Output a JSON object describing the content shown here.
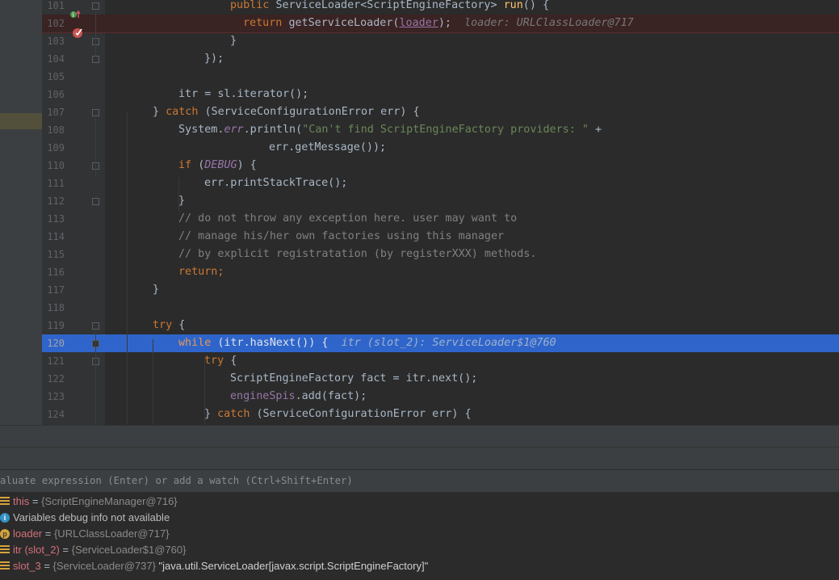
{
  "editor": {
    "lines": [
      {
        "num": "101",
        "segments": [
          {
            "t": "public ",
            "c": "kw"
          },
          {
            "t": "ServiceLoader<ScriptEngineFactory> ",
            "c": ""
          },
          {
            "t": "run",
            "c": "fn"
          },
          {
            "t": "() {",
            "c": ""
          }
        ]
      },
      {
        "num": "102",
        "segments": [
          {
            "t": "return ",
            "c": "kw"
          },
          {
            "t": "getServiceLoader(",
            "c": ""
          },
          {
            "t": "loader",
            "c": "ul"
          },
          {
            "t": ");  ",
            "c": ""
          },
          {
            "t": "loader: URLClassLoader@717",
            "c": "hint"
          }
        ]
      },
      {
        "num": "103",
        "segments": [
          {
            "t": "}",
            "c": ""
          }
        ]
      },
      {
        "num": "104",
        "segments": [
          {
            "t": "});",
            "c": ""
          }
        ]
      },
      {
        "num": "105",
        "segments": []
      },
      {
        "num": "106",
        "segments": [
          {
            "t": "itr = sl.iterator();",
            "c": ""
          }
        ]
      },
      {
        "num": "107",
        "segments": [
          {
            "t": "} ",
            "c": ""
          },
          {
            "t": "catch ",
            "c": "kw"
          },
          {
            "t": "(ServiceConfigurationError err) {",
            "c": ""
          }
        ]
      },
      {
        "num": "108",
        "segments": [
          {
            "t": "System.",
            "c": ""
          },
          {
            "t": "err",
            "c": "it"
          },
          {
            "t": ".println(",
            "c": ""
          },
          {
            "t": "\"Can't find ScriptEngineFactory providers: \"",
            "c": "str"
          },
          {
            "t": " +",
            "c": ""
          }
        ]
      },
      {
        "num": "109",
        "segments": [
          {
            "t": "err.getMessage());",
            "c": ""
          }
        ]
      },
      {
        "num": "110",
        "segments": [
          {
            "t": "if ",
            "c": "kw"
          },
          {
            "t": "(",
            "c": ""
          },
          {
            "t": "DEBUG",
            "c": "it"
          },
          {
            "t": ") {",
            "c": ""
          }
        ]
      },
      {
        "num": "111",
        "segments": [
          {
            "t": "err.printStackTrace();",
            "c": ""
          }
        ]
      },
      {
        "num": "112",
        "segments": [
          {
            "t": "}",
            "c": ""
          }
        ]
      },
      {
        "num": "113",
        "segments": [
          {
            "t": "// do not throw any exception here. user may want to",
            "c": "cm"
          }
        ]
      },
      {
        "num": "114",
        "segments": [
          {
            "t": "// manage his/her own factories using this manager",
            "c": "cm"
          }
        ]
      },
      {
        "num": "115",
        "segments": [
          {
            "t": "// by explicit registratation (by registerXXX) methods.",
            "c": "cm"
          }
        ]
      },
      {
        "num": "116",
        "segments": [
          {
            "t": "return;",
            "c": "kw"
          }
        ]
      },
      {
        "num": "117",
        "segments": [
          {
            "t": "}",
            "c": ""
          }
        ]
      },
      {
        "num": "118",
        "segments": []
      },
      {
        "num": "119",
        "segments": [
          {
            "t": "try ",
            "c": "kw"
          },
          {
            "t": "{",
            "c": ""
          }
        ]
      },
      {
        "num": "120",
        "segments": [
          {
            "t": "while ",
            "c": "kw"
          },
          {
            "t": "(itr.hasNext()) {  ",
            "c": ""
          },
          {
            "t": "itr (slot_2): ServiceLoader$1@760",
            "c": "hint-sel"
          }
        ]
      },
      {
        "num": "121",
        "segments": [
          {
            "t": "try ",
            "c": "kw"
          },
          {
            "t": "{",
            "c": ""
          }
        ]
      },
      {
        "num": "122",
        "segments": [
          {
            "t": "ScriptEngineFactory fact = itr.next();",
            "c": ""
          }
        ]
      },
      {
        "num": "123",
        "segments": [
          {
            "t": "engineSpis",
            "c": "fld"
          },
          {
            "t": ".add(fact);",
            "c": ""
          }
        ]
      },
      {
        "num": "124",
        "segments": [
          {
            "t": "} ",
            "c": ""
          },
          {
            "t": "catch ",
            "c": "kw"
          },
          {
            "t": "(ServiceConfigurationError err) {",
            "c": ""
          }
        ]
      }
    ],
    "current_line": "120",
    "breakpoint_line": "102"
  },
  "watch": {
    "placeholder": "aluate expression (Enter) or add a watch (Ctrl+Shift+Enter)"
  },
  "variables": [
    {
      "icon": "field-icon",
      "name": "this",
      "eq": " = ",
      "type": "{ScriptEngineManager@716}",
      "value": ""
    },
    {
      "icon": "info-icon",
      "name": "",
      "eq": "",
      "type": "",
      "value": "Variables debug info not available"
    },
    {
      "icon": "parameter-icon",
      "name": "loader",
      "eq": " = ",
      "type": "{URLClassLoader@717}",
      "value": ""
    },
    {
      "icon": "field-icon",
      "name": "itr (slot_2)",
      "eq": " = ",
      "type": "{ServiceLoader$1@760}",
      "value": ""
    },
    {
      "icon": "field-icon",
      "name": "slot_3",
      "eq": " = ",
      "type": "{ServiceLoader@737}",
      "value": " \"java.util.ServiceLoader[javax.script.ScriptEngineFactory]\""
    }
  ],
  "colors": {
    "selection": "#2f65ca",
    "breakpoint_row": "#3a2323",
    "editor_bg": "#2b2b2b"
  }
}
